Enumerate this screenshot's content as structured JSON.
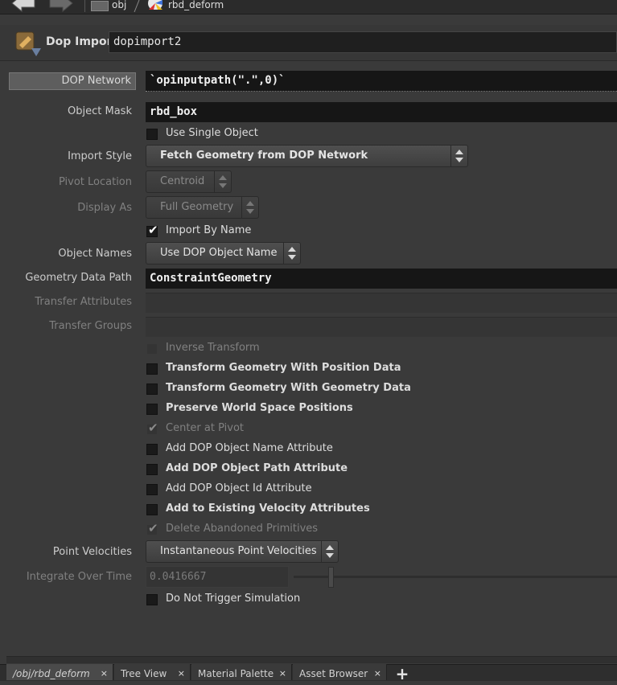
{
  "path_bar": {
    "crumbs": [
      "obj",
      "rbd_deform"
    ]
  },
  "header": {
    "node_type": "Dop Import",
    "node_name": "dopimport2"
  },
  "parms": {
    "dop_network": {
      "label": "DOP Network",
      "value": "`opinputpath(\".\",0)`"
    },
    "object_mask": {
      "label": "Object Mask",
      "value": "rbd_box"
    },
    "use_single_object": {
      "label": "Use Single Object",
      "checked": false
    },
    "import_style": {
      "label": "Import Style",
      "value": "Fetch Geometry from DOP Network"
    },
    "pivot_location": {
      "label": "Pivot Location",
      "value": "Centroid"
    },
    "display_as": {
      "label": "Display As",
      "value": "Full Geometry"
    },
    "import_by_name": {
      "label": "Import By Name",
      "checked": true
    },
    "object_names": {
      "label": "Object Names",
      "value": "Use DOP Object Name"
    },
    "geometry_data_path": {
      "label": "Geometry Data Path",
      "value": "ConstraintGeometry"
    },
    "transfer_attributes": {
      "label": "Transfer Attributes",
      "value": ""
    },
    "transfer_groups": {
      "label": "Transfer Groups",
      "value": ""
    },
    "toggles": [
      {
        "label": "Inverse Transform",
        "checked": false,
        "disabled": true,
        "bold": false
      },
      {
        "label": "Transform Geometry With Position Data",
        "checked": false,
        "disabled": false,
        "bold": true
      },
      {
        "label": "Transform Geometry With Geometry Data",
        "checked": false,
        "disabled": false,
        "bold": true
      },
      {
        "label": "Preserve World Space Positions",
        "checked": false,
        "disabled": false,
        "bold": true
      },
      {
        "label": "Center at Pivot",
        "checked": true,
        "disabled": true,
        "bold": false
      },
      {
        "label": "Add DOP Object Name Attribute",
        "checked": false,
        "disabled": false,
        "bold": false
      },
      {
        "label": "Add DOP Object Path Attribute",
        "checked": false,
        "disabled": false,
        "bold": true
      },
      {
        "label": "Add DOP Object Id Attribute",
        "checked": false,
        "disabled": false,
        "bold": false
      },
      {
        "label": "Add to Existing Velocity Attributes",
        "checked": false,
        "disabled": false,
        "bold": true
      },
      {
        "label": "Delete Abandoned Primitives",
        "checked": true,
        "disabled": true,
        "bold": false
      }
    ],
    "point_velocities": {
      "label": "Point Velocities",
      "value": "Instantaneous Point Velocities"
    },
    "integrate_over_time": {
      "label": "Integrate Over Time",
      "value": "0.0416667"
    },
    "do_not_trigger": {
      "label": "Do Not Trigger Simulation",
      "checked": false
    }
  },
  "tabs": [
    {
      "label": "/obj/rbd_deform",
      "active": true
    },
    {
      "label": "Tree View",
      "active": false
    },
    {
      "label": "Material Palette",
      "active": false
    },
    {
      "label": "Asset Browser",
      "active": false
    }
  ],
  "tab_close_glyph": "×",
  "add_tab_glyph": "+",
  "colors": {
    "panel_bg": "#3a3a3a",
    "field_bg": "#161616",
    "highlight_label_bg": "#5e5e5e"
  },
  "icons": {
    "back": "back-arrow-icon",
    "forward": "forward-arrow-icon",
    "obj": "obj-network-icon",
    "rbd": "rbd-geo-node-icon",
    "dopimport": "dop-import-node-icon"
  }
}
